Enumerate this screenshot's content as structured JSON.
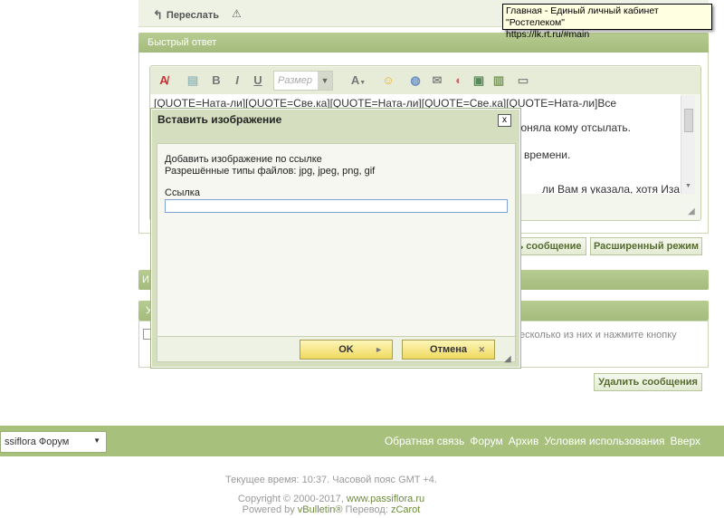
{
  "post_actions": {
    "forward_label": "Переслать"
  },
  "tooltip": {
    "line1": "Главная - Единый личный кабинет \"Ростелеком\"",
    "line2": "https://lk.rt.ru/#main"
  },
  "quick_reply": {
    "title": "Быстрый ответ",
    "toolbar": {
      "size_placeholder": "Размер",
      "bold": "B",
      "italic": "I",
      "underline": "U",
      "font": "A"
    },
    "text_lines": [
      "[QUOTE=Ната-ли][QUOTE=Све.ка][QUOTE=Ната-ли][QUOTE=Све.ка][QUOTE=Ната-ли]Все запаковала,",
      "поняла кому отсылать.",
      "о времени.",
      "ли Вам я указала, хотя Иза"
    ],
    "send_partial": "ь сообщение",
    "advanced_mode": "Расширенный режим"
  },
  "section_partial_a": "И",
  "section_partial_b": "У",
  "delete_hint_partial": "есколько из них и нажмите кнопку",
  "delete_button": "Удалить сообщения",
  "footer": {
    "forum_select": "ssiflora Форум",
    "links": [
      "Обратная связь",
      "Форум",
      "Архив",
      "Условия использования",
      "Вверх"
    ],
    "time_line": "Текущее время: 10:37. Часовой пояс GMT +4.",
    "copyright_prefix": "Copyright © 2000-2017, ",
    "copyright_link": "www.passiflora.ru",
    "powered_prefix": "Powered by ",
    "powered_brand": "vBulletin®",
    "powered_suffix": " Перевод: ",
    "translator": "zCarot"
  },
  "dialog": {
    "title": "Вставить изображение",
    "close": "x",
    "desc_line1": "Добавить изображение по ссылке",
    "desc_line2": "Разрешённые типы файлов: jpg, jpeg, png, gif",
    "link_label": "Ссылка",
    "link_value": "",
    "ok": "OK",
    "cancel": "Отмена"
  }
}
